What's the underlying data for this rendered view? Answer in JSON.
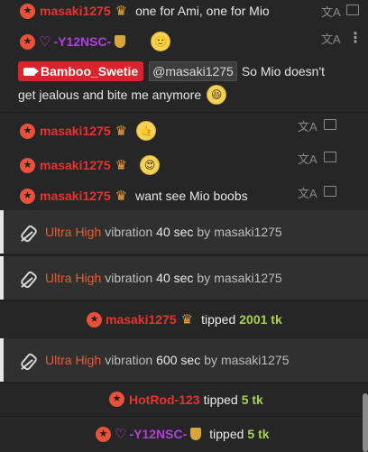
{
  "messages": [
    {
      "user": "masaki1275",
      "text": "one for Ami, one for Mio"
    },
    {
      "user": "-Y12NSC-",
      "emoji": "🙂"
    },
    {
      "broadcaster": "Bamboo_Swetie",
      "mention": "@masaki1275",
      "text_line1": "So Mio doesn't",
      "text_line2": "get jealous and bite me anymore",
      "emoji": "😆"
    },
    {
      "user": "masaki1275",
      "emoji": "🤙"
    },
    {
      "user": "masaki1275",
      "emoji": "😍"
    },
    {
      "user": "masaki1275",
      "text": "want see Mio boobs"
    }
  ],
  "vibrations": [
    {
      "level": "Ultra High",
      "word": "vibration",
      "duration": "40 sec",
      "by": "by",
      "user": "masaki1275"
    },
    {
      "level": "Ultra High",
      "word": "vibration",
      "duration": "40 sec",
      "by": "by",
      "user": "masaki1275"
    },
    {
      "level": "Ultra High",
      "word": "vibration",
      "duration": "600 sec",
      "by": "by",
      "user": "masaki1275"
    }
  ],
  "tips": [
    {
      "user": "masaki1275",
      "verb": "tipped",
      "amount": "2001 tk"
    },
    {
      "user": "HotRod-123",
      "verb": "tipped",
      "amount": "5 tk"
    },
    {
      "user": "-Y12NSC-",
      "verb": "tipped",
      "amount": "5 tk"
    }
  ],
  "icons": {
    "star": "★",
    "crown": "♛",
    "heart": "♡",
    "translate": "文A",
    "kebab": "⋮"
  },
  "colors": {
    "accent_red": "#e8332f",
    "ultra": "#ea5a33",
    "tip_green": "#a8d24e",
    "purple": "#b13fe0"
  }
}
